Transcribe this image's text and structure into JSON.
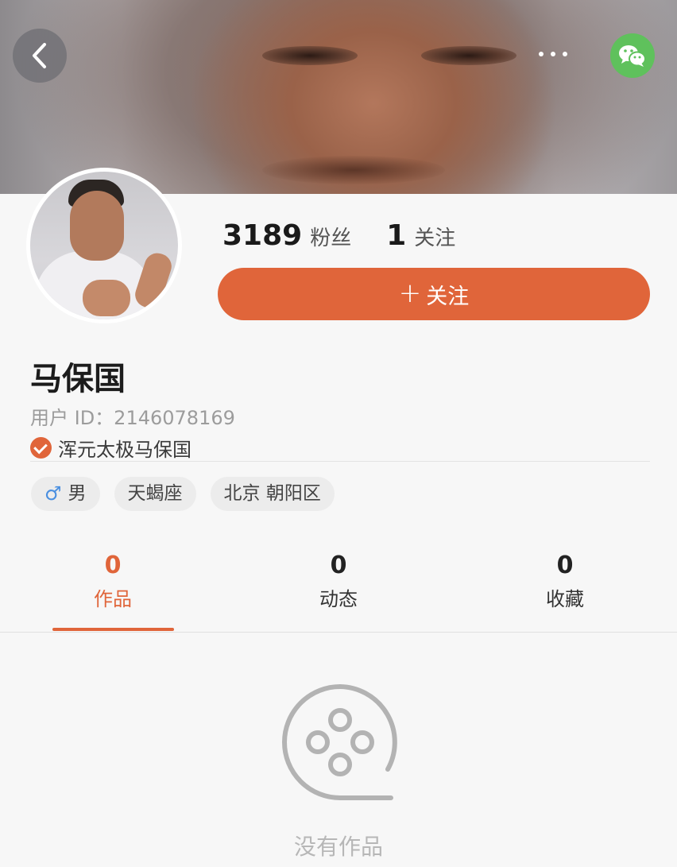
{
  "header": {
    "back_icon": "chevron-left-icon",
    "more_icon": "more-horizontal-icon",
    "share_icon": "wechat-icon"
  },
  "profile": {
    "fans_count": "3189",
    "fans_label": "粉丝",
    "following_count": "1",
    "following_label": "关注",
    "follow_button_label": "关注",
    "name": "马保国",
    "user_id": "用户 ID：2146078169",
    "verified_label": "浑元太极马保国",
    "tags": {
      "gender": "男",
      "zodiac": "天蝎座",
      "location": "北京 朝阳区"
    }
  },
  "tabs": [
    {
      "count": "0",
      "label": "作品",
      "active": true
    },
    {
      "count": "0",
      "label": "动态",
      "active": false
    },
    {
      "count": "0",
      "label": "收藏",
      "active": false
    }
  ],
  "empty_state": {
    "icon": "film-reel-icon",
    "text": "没有作品"
  },
  "colors": {
    "accent": "#e0653a",
    "wechat": "#5fc15c"
  }
}
